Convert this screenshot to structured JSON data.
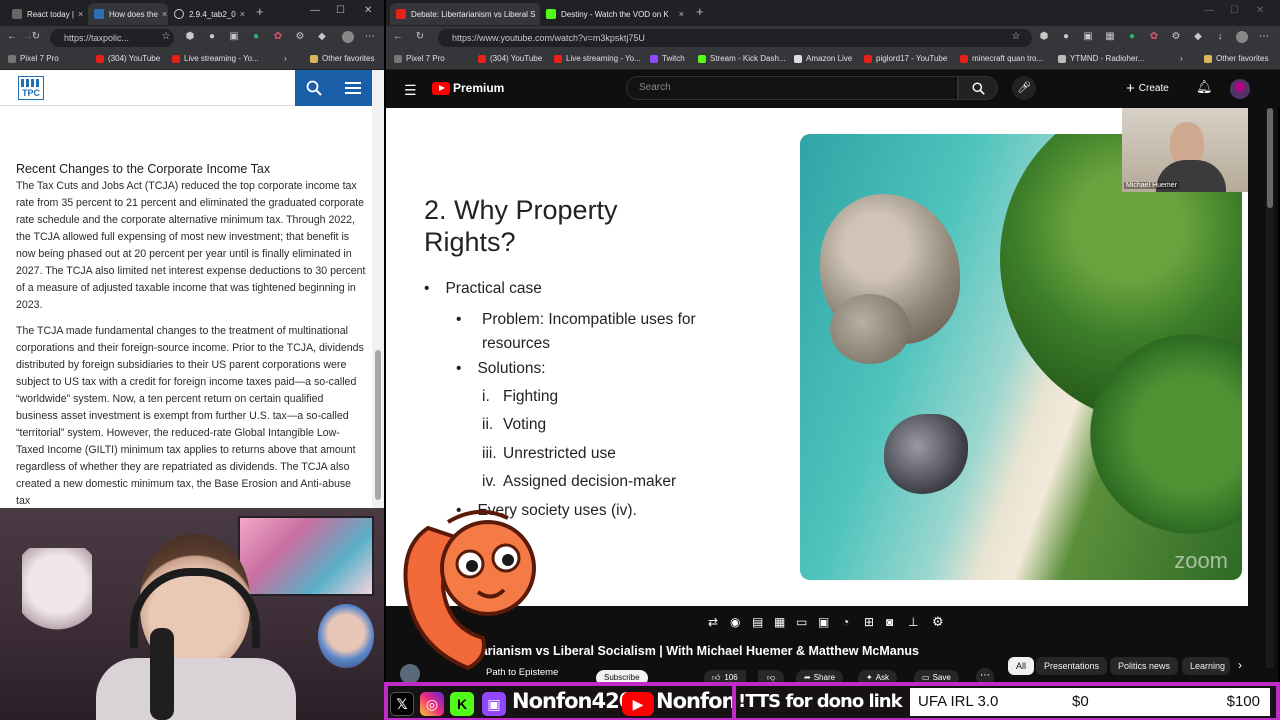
{
  "left_window": {
    "tabs": [
      {
        "label": "React today |",
        "color": "#555"
      },
      {
        "label": "How does the",
        "color": "#2d6fb5"
      },
      {
        "label": "2.9.4_tab2_0",
        "color": "#888"
      }
    ],
    "url": "https://taxpolic...",
    "bookmarks": [
      {
        "label": "Pixel 7 Pro",
        "color": "#777"
      },
      {
        "label": "(304) YouTube",
        "color": "#e62117"
      },
      {
        "label": "Live streaming - Yo...",
        "color": "#e62117"
      }
    ],
    "other_favorites": "Other favorites",
    "site_logo": "TPC",
    "article": {
      "heading": "Recent Changes to the Corporate Income Tax",
      "p1": "The Tax Cuts and Jobs Act (TCJA) reduced the top corporate income tax rate from 35 percent to 21 percent and eliminated the graduated corporate rate schedule and the corporate alternative minimum tax. Through 2022, the TCJA allowed full expensing of most new investment; that benefit is now being phased out at 20 percent per year until is finally eliminated in 2027. The TCJA also limited net interest expense deductions to 30 percent of a measure of adjusted taxable income that was tightened beginning in 2023.",
      "p2": "The TCJA made fundamental changes to the treatment of multinational corporations and their foreign-source income. Prior to the TCJA, dividends distributed by foreign subsidiaries to their US parent corporations were subject to US tax with a credit for foreign income taxes paid—a so-called “worldwide” system.  Now, a ten percent return on certain qualified business asset investment is exempt from further U.S. tax—a so-called “territorial” system. However, the reduced-rate Global Intangible Low-Taxed Income (GILTI) minimum tax applies to returns above that amount regardless of whether they are repatriated as dividends. The TCJA also created a new domestic minimum tax, the Base Erosion and Anti-abuse tax"
    }
  },
  "right_window": {
    "tabs": [
      {
        "label": "Debate: Libertarianism vs Liberal S",
        "color": "#e62117"
      },
      {
        "label": "Destiny - Watch the VOD on K",
        "color": "#53fc18"
      }
    ],
    "url": "https://www.youtube.com/watch?v=m3kpsktj75U",
    "bookmarks": [
      {
        "label": "Pixel 7 Pro",
        "color": "#777"
      },
      {
        "label": "(304) YouTube",
        "color": "#e62117"
      },
      {
        "label": "Live streaming - Yo...",
        "color": "#e62117"
      },
      {
        "label": "Twitch",
        "color": "#9146ff"
      },
      {
        "label": "Stream - Kick Dash...",
        "color": "#53fc18"
      },
      {
        "label": "Amazon Live",
        "color": "#ccc"
      },
      {
        "label": "piglord17 - YouTube",
        "color": "#e62117"
      },
      {
        "label": "minecraft quan tro...",
        "color": "#e62117"
      },
      {
        "label": "YTMND - Radioher...",
        "color": "#bbb"
      }
    ],
    "other_favorites": "Other favorites",
    "youtube": {
      "logo": "Premium",
      "search_placeholder": "Search",
      "create": "Create"
    },
    "slide": {
      "title": "2. Why Property Rights?",
      "bullet1": "Practical case",
      "sub1": "Problem: Incompatible uses for resources",
      "sub2": "Solutions:",
      "items": [
        {
          "num": "i.",
          "text": "Fighting"
        },
        {
          "num": "ii.",
          "text": "Voting"
        },
        {
          "num": "iii.",
          "text": "Unrestricted use"
        },
        {
          "num": "iv.",
          "text": "Assigned decision-maker"
        }
      ],
      "sub3": "Every society uses (iv).",
      "cam_name": "Michael Huemer",
      "watermark": "zoom"
    },
    "video": {
      "title": "Libertarianism vs Liberal Socialism | With Michael Huemer & Matthew McManus",
      "channel": "Path to Episteme",
      "subscribe": "Subscribe",
      "likes": "106",
      "share": "Share",
      "ask": "Ask",
      "save": "Save"
    },
    "chips": [
      "All",
      "Presentations",
      "Politics news",
      "Learning"
    ]
  },
  "overlay": {
    "name1": "Nonfon420",
    "name2": "Nonfon",
    "tts": "!TTS for dono link",
    "goal_label": "UFA IRL 3.0",
    "goal_current": "$0",
    "goal_target": "$100"
  }
}
